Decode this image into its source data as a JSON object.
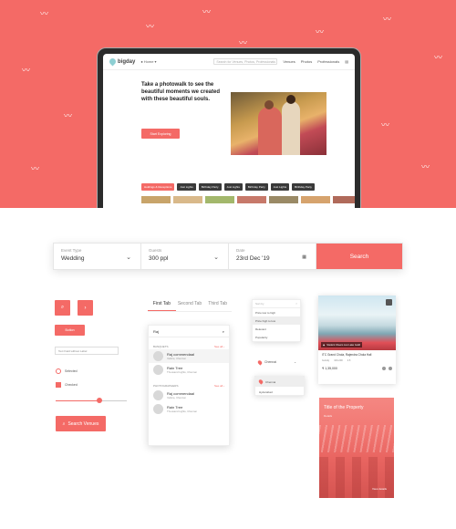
{
  "laptop": {
    "nav": {
      "logo": "bigday",
      "city": "Home",
      "search_placeholder": "Search for Venues, Photos, Professionals",
      "links": [
        "Venues",
        "Photos",
        "Professionals"
      ]
    },
    "hero_title": "Take a photowalk to see the beautiful moments we created with these beautiful souls.",
    "hero_button": "Start Exploring",
    "chips": [
      "Holdings & Receptions",
      "Just Lights",
      "Birthday Party",
      "Just Lights",
      "Birthday Party",
      "Just Lights",
      "Birthday Party"
    ]
  },
  "search_bar": {
    "event_type": {
      "label": "Event Type",
      "value": "Wedding"
    },
    "guests": {
      "label": "Guests",
      "value": "300 ppl"
    },
    "date": {
      "label": "Date",
      "value": "23rd Dec '19"
    },
    "button": "Search"
  },
  "controls": {
    "small_button": "Button",
    "text_field": "Text Field without Label",
    "radio_label": "Selected",
    "checkbox_label": "Checked",
    "slider_value": 0.62,
    "search_button": "Search Venues"
  },
  "tabs": [
    "First Tab",
    "Second Tab",
    "Third Tab"
  ],
  "dropdown": {
    "query": "Raj",
    "sections": [
      {
        "title": "BANQUETS",
        "see_all": "See all",
        "items": [
          {
            "name": "Raj commendaal",
            "sub": "Vellore, Chennai"
          },
          {
            "name": "Rain Tree",
            "sub": "Thousand Lights, Chennai"
          }
        ]
      },
      {
        "title": "PHOTOGRAPHERS",
        "see_all": "See all",
        "items": [
          {
            "name": "Raj commendaal",
            "sub": "Vellore, Chennai"
          },
          {
            "name": "Rain Tree",
            "sub": "Thousand Lights, Chennai"
          }
        ]
      }
    ]
  },
  "sort": {
    "header": "Sort by",
    "options": [
      "Price low to high",
      "Price high to low",
      "Relevant",
      "Popularity"
    ],
    "selected": 1
  },
  "location": {
    "value": "Chennai",
    "options": [
      "Chennai",
      "Hyderabad"
    ]
  },
  "card1": {
    "caption": "Student Cheers Live Lake Guild",
    "title": "ITC Grand Chola, Rajendra Chola Hall",
    "meta": [
      "Guindy",
      "100-200",
      "4.5"
    ],
    "price": "₹ 1,35,000"
  },
  "card2": {
    "title": "Title of the Property",
    "subtitle": "Details",
    "link": "View details"
  },
  "colors": {
    "accent": "#f46a66",
    "dark": "#2b2b2b"
  }
}
